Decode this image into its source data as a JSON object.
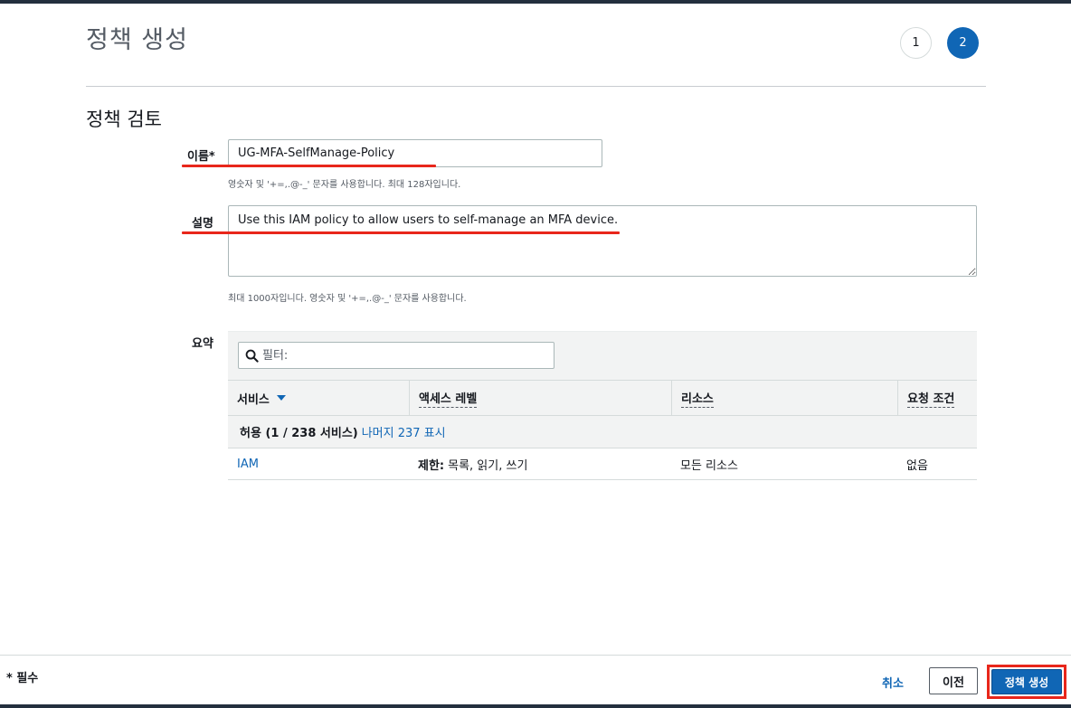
{
  "header": {
    "title": "정책 생성",
    "steps": [
      "1",
      "2"
    ],
    "active_step": 2
  },
  "review": {
    "section_title": "정책 검토",
    "name": {
      "label": "이름*",
      "value": "UG-MFA-SelfManage-Policy",
      "hint": "영숫자 및 '+=,.@-_' 문자를 사용합니다. 최대 128자입니다."
    },
    "description": {
      "label": "설명",
      "value": "Use this IAM policy to allow users to self-manage an MFA device.",
      "hint": "최대 1000자입니다. 영숫자 및 '+=,.@-_' 문자를 사용합니다."
    },
    "summary": {
      "label": "요약",
      "filter_placeholder": "필터:",
      "columns": {
        "service": "서비스",
        "access_level": "액세스 레벨",
        "resource": "리소스",
        "condition": "요청 조건"
      },
      "group": {
        "label": "허용 (1 / 238 서비스)",
        "link": "나머지 237 표시"
      },
      "rows": [
        {
          "service": "IAM",
          "access_prefix": "제한:",
          "access_value": "목록, 읽기, 쓰기",
          "resource": "모든 리소스",
          "condition": "없음"
        }
      ]
    }
  },
  "footer": {
    "required_note": "* 필수",
    "cancel_label": "취소",
    "previous_label": "이전",
    "create_label": "정책 생성"
  },
  "colors": {
    "accent": "#1066b5",
    "highlight": "#e8261b",
    "top_bar": "#232f3e"
  }
}
